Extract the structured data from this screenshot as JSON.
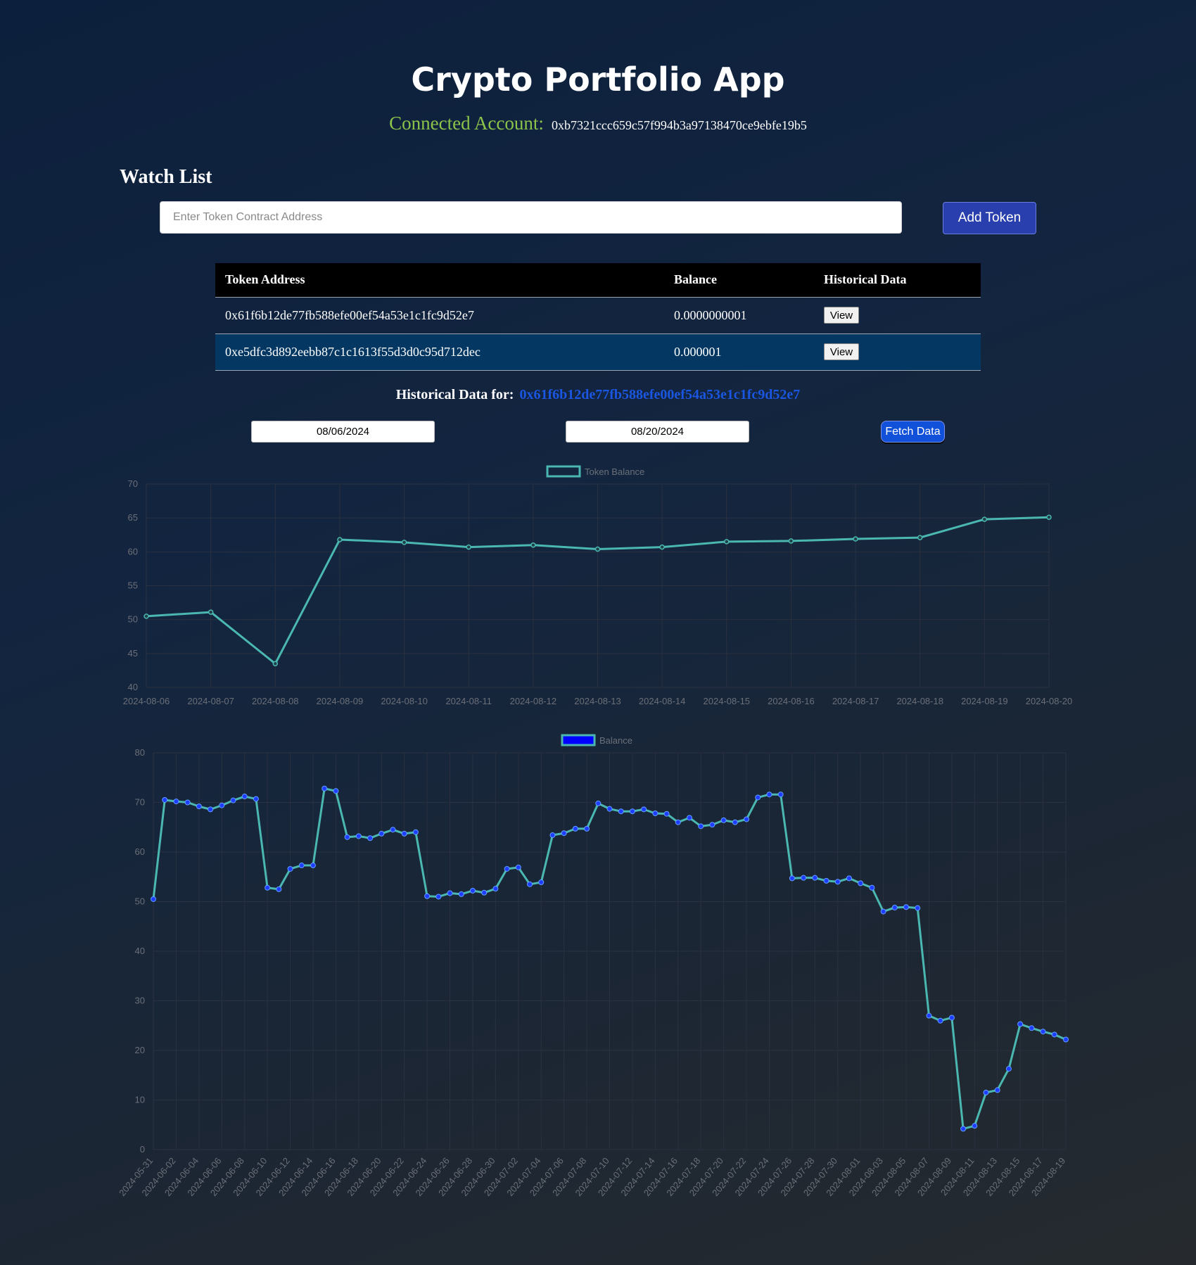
{
  "app_title": "Crypto Portfolio App",
  "account": {
    "label": "Connected Account:",
    "address": "0xb7321ccc659c57f994b3a97138470ce9ebfe19b5"
  },
  "watch_list": {
    "heading": "Watch List",
    "input_placeholder": "Enter Token Contract Address",
    "add_button": "Add Token",
    "columns": [
      "Token Address",
      "Balance",
      "Historical Data"
    ],
    "rows": [
      {
        "address": "0x61f6b12de77fb588efe00ef54a53e1c1fc9d52e7",
        "balance": "0.0000000001",
        "action": "View"
      },
      {
        "address": "0xe5dfc3d892eebb87c1c1613f55d3d0c95d712dec",
        "balance": "0.000001",
        "action": "View"
      }
    ]
  },
  "historical": {
    "label": "Historical Data for:",
    "address": "0x61f6b12de77fb588efe00ef54a53e1c1fc9d52e7",
    "start_date": "08/06/2024",
    "end_date": "08/20/2024",
    "fetch_button": "Fetch Data"
  },
  "colors": {
    "line": "#4ab8b0",
    "point_blue": "#1f3cff",
    "legend_blue": "#0000ff",
    "grid": "#2a3140"
  },
  "chart_data": [
    {
      "type": "line",
      "legend": "Token Balance",
      "ylim": [
        40,
        70
      ],
      "yticks": [
        40,
        45,
        50,
        55,
        60,
        65,
        70
      ],
      "categories": [
        "2024-08-06",
        "2024-08-07",
        "2024-08-08",
        "2024-08-09",
        "2024-08-10",
        "2024-08-11",
        "2024-08-12",
        "2024-08-13",
        "2024-08-14",
        "2024-08-15",
        "2024-08-16",
        "2024-08-17",
        "2024-08-18",
        "2024-08-19",
        "2024-08-20"
      ],
      "values": [
        50.5,
        51.1,
        43.5,
        61.8,
        61.4,
        60.7,
        61.0,
        60.4,
        60.7,
        61.5,
        61.6,
        61.9,
        62.1,
        64.8,
        65.1
      ]
    },
    {
      "type": "line",
      "legend": "Balance",
      "ylim": [
        0,
        80
      ],
      "yticks": [
        0,
        10,
        20,
        30,
        40,
        50,
        60,
        70,
        80
      ],
      "tick_labels": [
        "2024-05-31",
        "2024-06-02",
        "2024-06-04",
        "2024-06-06",
        "2024-06-08",
        "2024-06-10",
        "2024-06-12",
        "2024-06-14",
        "2024-06-16",
        "2024-06-18",
        "2024-06-20",
        "2024-06-22",
        "2024-06-24",
        "2024-06-26",
        "2024-06-28",
        "2024-06-30",
        "2024-07-02",
        "2024-07-04",
        "2024-07-06",
        "2024-07-08",
        "2024-07-10",
        "2024-07-12",
        "2024-07-14",
        "2024-07-16",
        "2024-07-18",
        "2024-07-20",
        "2024-07-22",
        "2024-07-24",
        "2024-07-26",
        "2024-07-28",
        "2024-07-30",
        "2024-08-01",
        "2024-08-03",
        "2024-08-05",
        "2024-08-07",
        "2024-08-09",
        "2024-08-11",
        "2024-08-13",
        "2024-08-15",
        "2024-08-17",
        "2024-08-19"
      ],
      "x_start": "2024-05-31",
      "values": [
        50.5,
        70.5,
        70.2,
        70.0,
        69.2,
        68.6,
        69.4,
        70.4,
        71.2,
        70.7,
        52.8,
        52.5,
        56.6,
        57.3,
        57.3,
        72.8,
        72.3,
        63.0,
        63.2,
        62.8,
        63.7,
        64.5,
        63.7,
        64.0,
        51.1,
        51.0,
        51.7,
        51.5,
        52.2,
        51.8,
        52.6,
        56.6,
        56.9,
        53.5,
        53.9,
        63.4,
        63.8,
        64.7,
        64.7,
        69.8,
        68.7,
        68.2,
        68.2,
        68.6,
        67.8,
        67.7,
        66.0,
        66.9,
        65.2,
        65.5,
        66.4,
        66.0,
        66.6,
        71.0,
        71.6,
        71.6,
        54.7,
        54.8,
        54.8,
        54.2,
        54.0,
        54.7,
        53.7,
        52.8,
        48.0,
        48.8,
        48.9,
        48.7,
        27.0,
        26.0,
        26.6,
        4.2,
        4.8,
        11.5,
        12.0,
        16.3,
        25.3,
        24.5,
        23.8,
        23.2,
        22.2
      ]
    }
  ]
}
